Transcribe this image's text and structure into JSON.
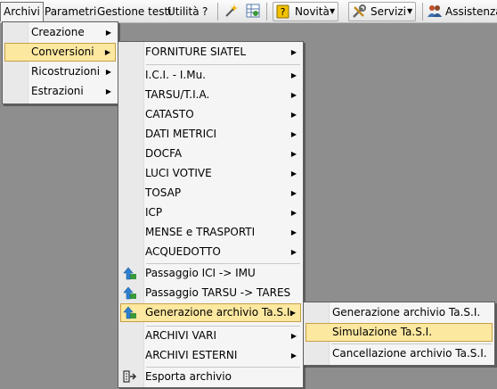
{
  "menubar": {
    "items": [
      "Archivi",
      "Parametri",
      "Gestione testi",
      "Utilità",
      "?"
    ],
    "buttons": {
      "novita": "Novità",
      "servizi": "Servizi",
      "assistenza": "Assistenza"
    }
  },
  "menu_archivi": {
    "items": [
      "Creazione",
      "Conversioni",
      "Ricostruzioni",
      "Estrazioni"
    ]
  },
  "menu_conversioni": {
    "items": [
      "FORNITURE SIATEL",
      "I.C.I. - I.Mu.",
      "TARSU/T.I.A.",
      "CATASTO",
      "DATI METRICI",
      "DOCFA",
      "LUCI VOTIVE",
      "TOSAP",
      "ICP",
      "MENSE e TRASPORTI",
      "ACQUEDOTTO",
      "Passaggio ICI -> IMU",
      "Passaggio TARSU -> TARES",
      "Generazione archivio Ta.S.I.",
      "ARCHIVI VARI",
      "ARCHIVI ESTERNI",
      "Esporta archivio"
    ]
  },
  "menu_tasi": {
    "items": [
      "Generazione archivio Ta.S.I.",
      "Simulazione Ta.S.I.",
      "Cancellazione archivio Ta.S.I."
    ]
  },
  "colors": {
    "highlight_bg": "#fde8a0",
    "highlight_border": "#c89f47",
    "menu_bg": "#f5f5f5",
    "desktop_bg": "#8e8e8e"
  }
}
